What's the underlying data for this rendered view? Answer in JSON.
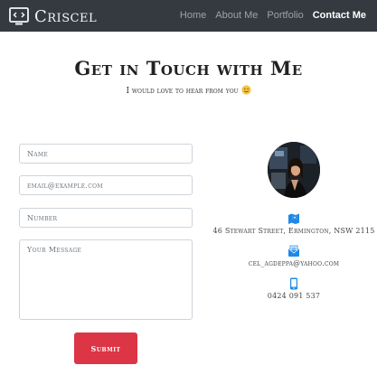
{
  "brand": {
    "name": "Criscel",
    "icon": "code-window-icon"
  },
  "nav": {
    "items": [
      {
        "label": "Home",
        "active": false
      },
      {
        "label": "About Me",
        "active": false
      },
      {
        "label": "Portfolio",
        "active": false
      },
      {
        "label": "Contact Me",
        "active": true
      }
    ]
  },
  "header": {
    "title": "Get in Touch with Me",
    "subtitle": "I would love to hear from you",
    "subtitle_emoji": "smiling-face-icon"
  },
  "form": {
    "name_placeholder": "Name",
    "email_placeholder": "email@example.com",
    "number_placeholder": "Number",
    "message_placeholder": "Your Message",
    "submit_label": "Submit"
  },
  "contact": {
    "address": "46 Stewart Street, Ermington, NSW 2115",
    "address_icon": "map-marker-icon",
    "email": "cel_agdeppa@yahoo.com",
    "email_icon": "envelope-icon",
    "phone": "0424 091 537",
    "phone_icon": "mobile-phone-icon"
  },
  "colors": {
    "navbar_bg": "#343a40",
    "accent_blue": "#1e88e5",
    "submit_red": "#dc3545",
    "emoji_yellow": "#f5c542"
  }
}
